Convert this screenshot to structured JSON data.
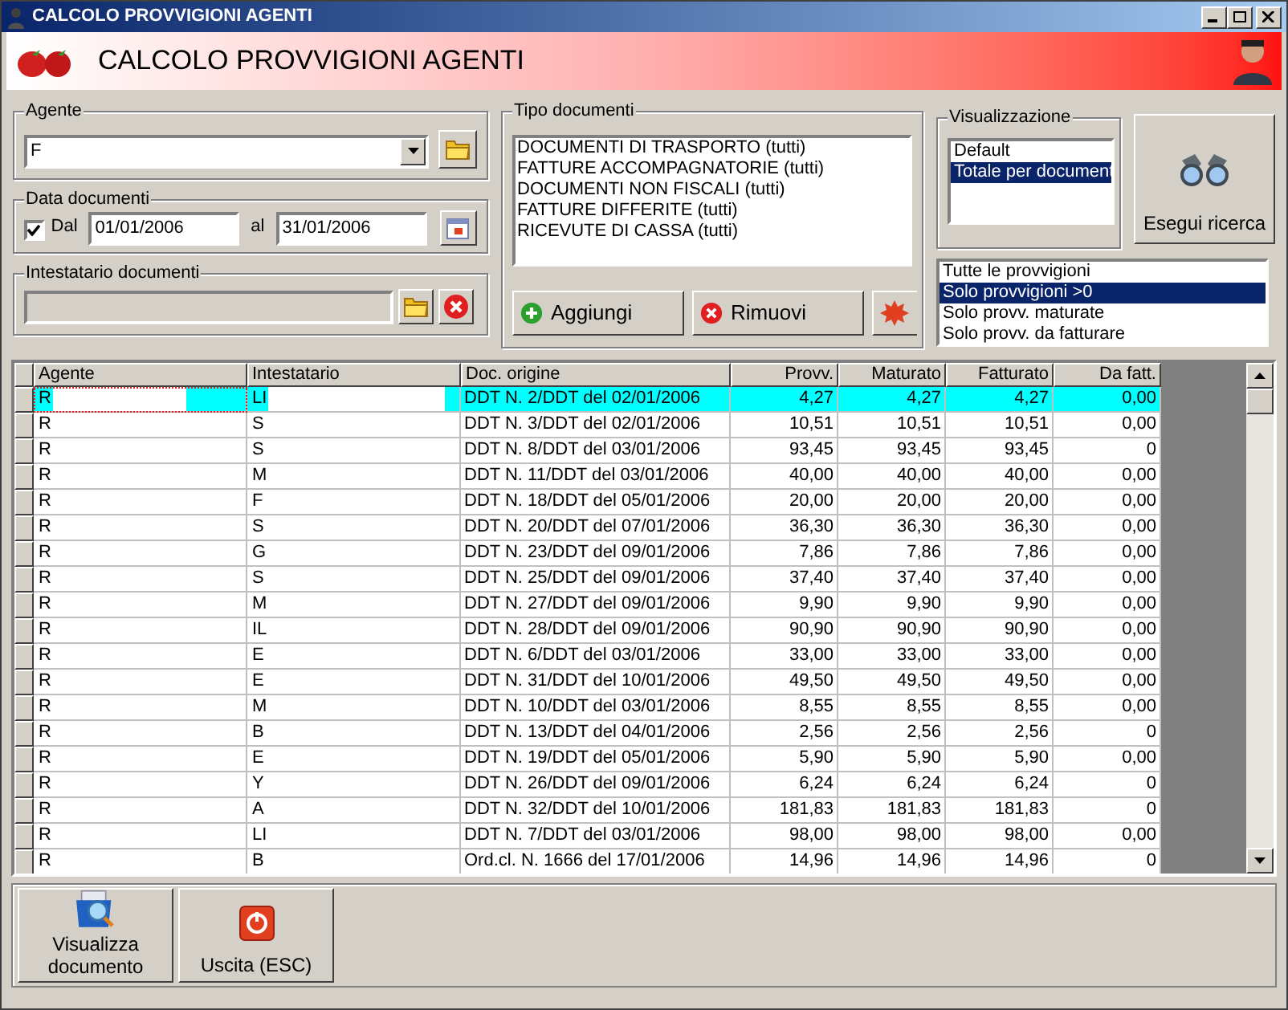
{
  "window": {
    "title": "CALCOLO PROVVIGIONI AGENTI"
  },
  "header": {
    "title": "CALCOLO PROVVIGIONI AGENTI"
  },
  "agente": {
    "label": "Agente",
    "value": "F"
  },
  "data_documenti": {
    "label": "Data documenti",
    "checkbox": {
      "label": "Dal",
      "checked": true
    },
    "from": "01/01/2006",
    "to_label": "al",
    "to": "31/01/2006"
  },
  "intestatario": {
    "label": "Intestatario documenti"
  },
  "tipo_documenti": {
    "label": "Tipo documenti",
    "items": [
      "DOCUMENTI DI TRASPORTO (tutti)",
      "FATTURE ACCOMPAGNATORIE (tutti)",
      "DOCUMENTI NON FISCALI (tutti)",
      "FATTURE DIFFERITE (tutti)",
      "RICEVUTE DI CASSA (tutti)"
    ],
    "buttons": [
      {
        "label": "Aggiungi",
        "kind": "add"
      },
      {
        "label": "Rimuovi",
        "kind": "remove"
      },
      {
        "kind": "clear"
      }
    ]
  },
  "visualizzazione": {
    "label": "Visualizzazione",
    "items": [
      {
        "label": "Default",
        "selected": false
      },
      {
        "label": "Totale per document",
        "selected": true
      }
    ]
  },
  "search_button": {
    "label": "Esegui ricerca"
  },
  "filter": {
    "items": [
      {
        "label": "Tutte le provvigioni",
        "selected": false
      },
      {
        "label": "Solo provvigioni >0",
        "selected": true
      },
      {
        "label": "Solo provv. maturate",
        "selected": false
      },
      {
        "label": "Solo provv. da fatturare",
        "selected": false
      }
    ]
  },
  "table": {
    "columns": [
      "Agente",
      "Intestatario",
      "Doc. origine",
      "Provv.",
      "Maturato",
      "Fatturato",
      "Da fatt."
    ],
    "rows": [
      {
        "selected": true,
        "cells": [
          "R",
          "LI",
          "DDT N. 2/DDT del 02/01/2006",
          "4,27",
          "4,27",
          "4,27",
          "0,00"
        ]
      },
      {
        "selected": false,
        "cells": [
          "R",
          "S",
          "DDT N. 3/DDT del 02/01/2006",
          "10,51",
          "10,51",
          "10,51",
          "0,00"
        ]
      },
      {
        "selected": false,
        "cells": [
          "R",
          "S",
          "DDT N. 8/DDT del 03/01/2006",
          "93,45",
          "93,45",
          "93,45",
          "0"
        ]
      },
      {
        "selected": false,
        "cells": [
          "R",
          "M",
          "DDT N. 11/DDT del 03/01/2006",
          "40,00",
          "40,00",
          "40,00",
          "0,00"
        ]
      },
      {
        "selected": false,
        "cells": [
          "R",
          "F",
          "DDT N. 18/DDT del 05/01/2006",
          "20,00",
          "20,00",
          "20,00",
          "0,00"
        ]
      },
      {
        "selected": false,
        "cells": [
          "R",
          "S",
          "DDT N. 20/DDT del 07/01/2006",
          "36,30",
          "36,30",
          "36,30",
          "0,00"
        ]
      },
      {
        "selected": false,
        "cells": [
          "R",
          "G",
          "DDT N. 23/DDT del 09/01/2006",
          "7,86",
          "7,86",
          "7,86",
          "0,00"
        ]
      },
      {
        "selected": false,
        "cells": [
          "R",
          "S",
          "DDT N. 25/DDT del 09/01/2006",
          "37,40",
          "37,40",
          "37,40",
          "0,00"
        ]
      },
      {
        "selected": false,
        "cells": [
          "R",
          "M",
          "DDT N. 27/DDT del 09/01/2006",
          "9,90",
          "9,90",
          "9,90",
          "0,00"
        ]
      },
      {
        "selected": false,
        "cells": [
          "R",
          "IL",
          "DDT N. 28/DDT del 09/01/2006",
          "90,90",
          "90,90",
          "90,90",
          "0,00"
        ]
      },
      {
        "selected": false,
        "cells": [
          "R",
          "E",
          "DDT N. 6/DDT del 03/01/2006",
          "33,00",
          "33,00",
          "33,00",
          "0,00"
        ]
      },
      {
        "selected": false,
        "cells": [
          "R",
          "E",
          "DDT N. 31/DDT del 10/01/2006",
          "49,50",
          "49,50",
          "49,50",
          "0,00"
        ]
      },
      {
        "selected": false,
        "cells": [
          "R",
          "M",
          "DDT N. 10/DDT del 03/01/2006",
          "8,55",
          "8,55",
          "8,55",
          "0,00"
        ]
      },
      {
        "selected": false,
        "cells": [
          "R",
          "B",
          "DDT N. 13/DDT del 04/01/2006",
          "2,56",
          "2,56",
          "2,56",
          "0"
        ]
      },
      {
        "selected": false,
        "cells": [
          "R",
          "E",
          "DDT N. 19/DDT del 05/01/2006",
          "5,90",
          "5,90",
          "5,90",
          "0,00"
        ]
      },
      {
        "selected": false,
        "cells": [
          "R",
          "Y",
          "DDT N. 26/DDT del 09/01/2006",
          "6,24",
          "6,24",
          "6,24",
          "0"
        ]
      },
      {
        "selected": false,
        "cells": [
          "R",
          "A",
          "DDT N. 32/DDT del 10/01/2006",
          "181,83",
          "181,83",
          "181,83",
          "0"
        ]
      },
      {
        "selected": false,
        "cells": [
          "R",
          "LI",
          "DDT N. 7/DDT del 03/01/2006",
          "98,00",
          "98,00",
          "98,00",
          "0,00"
        ]
      },
      {
        "selected": false,
        "cells": [
          "R",
          "B",
          "Ord.cl. N. 1666 del 17/01/2006",
          "14,96",
          "14,96",
          "14,96",
          "0"
        ]
      }
    ]
  },
  "footer_buttons": [
    {
      "label": "Visualizza documento",
      "kind": "view"
    },
    {
      "label": "Uscita (ESC)",
      "kind": "exit"
    }
  ]
}
